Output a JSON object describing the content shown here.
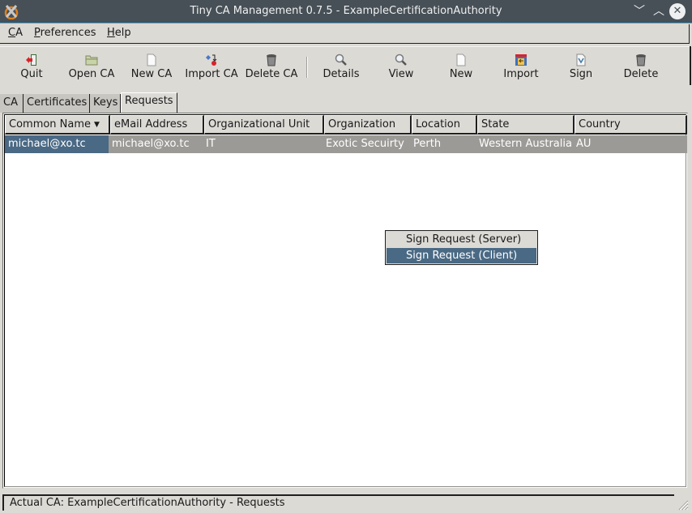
{
  "window": {
    "title": "Tiny CA Management 0.7.5 - ExampleCertificationAuthority",
    "controls": {
      "minimize": "﹀",
      "maximize": "︿",
      "close": "✕"
    }
  },
  "menubar": {
    "items": [
      {
        "mnemonic": "C",
        "rest": "A"
      },
      {
        "mnemonic": "P",
        "rest": "references"
      },
      {
        "mnemonic": "H",
        "rest": "elp"
      }
    ]
  },
  "toolbar": {
    "ca_group": [
      {
        "label": "Quit",
        "icon": "quit-icon"
      },
      {
        "label": "Open CA",
        "icon": "folder-open-icon"
      },
      {
        "label": "New CA",
        "icon": "new-document-icon"
      },
      {
        "label": "Import CA",
        "icon": "import-ca-icon"
      },
      {
        "label": "Delete CA",
        "icon": "trash-icon"
      }
    ],
    "item_group": [
      {
        "label": "Details",
        "icon": "magnifier-icon"
      },
      {
        "label": "View",
        "icon": "magnifier-icon"
      },
      {
        "label": "New",
        "icon": "new-document-icon"
      },
      {
        "label": "Import",
        "icon": "import-icon"
      },
      {
        "label": "Sign",
        "icon": "sign-icon"
      },
      {
        "label": "Delete",
        "icon": "trash-icon"
      }
    ]
  },
  "tabs": [
    {
      "label": "CA",
      "active": false
    },
    {
      "label": "Certificates",
      "active": false
    },
    {
      "label": "Keys",
      "active": false
    },
    {
      "label": "Requests",
      "active": true
    }
  ],
  "table": {
    "columns": [
      "Common Name",
      "eMail Address",
      "Organizational Unit",
      "Organization",
      "Location",
      "State",
      "Country"
    ],
    "sort_indicator": "▼",
    "rows": [
      [
        "michael@xo.tc",
        "michael@xo.tc",
        "IT",
        "Exotic Secuirty",
        "Perth",
        "Western Australia",
        "AU"
      ]
    ]
  },
  "context_menu": {
    "items": [
      {
        "label": "Sign Request (Server)",
        "highlighted": false
      },
      {
        "label": "Sign Request (Client)",
        "highlighted": true
      }
    ]
  },
  "statusbar": {
    "text": "Actual CA: ExampleCertificationAuthority - Requests"
  },
  "colors": {
    "titlebar": "#475057",
    "accent": "#3daee9",
    "selection": "#4a6984",
    "row_bg": "#9c9a96",
    "window_bg": "#dcdad5"
  }
}
